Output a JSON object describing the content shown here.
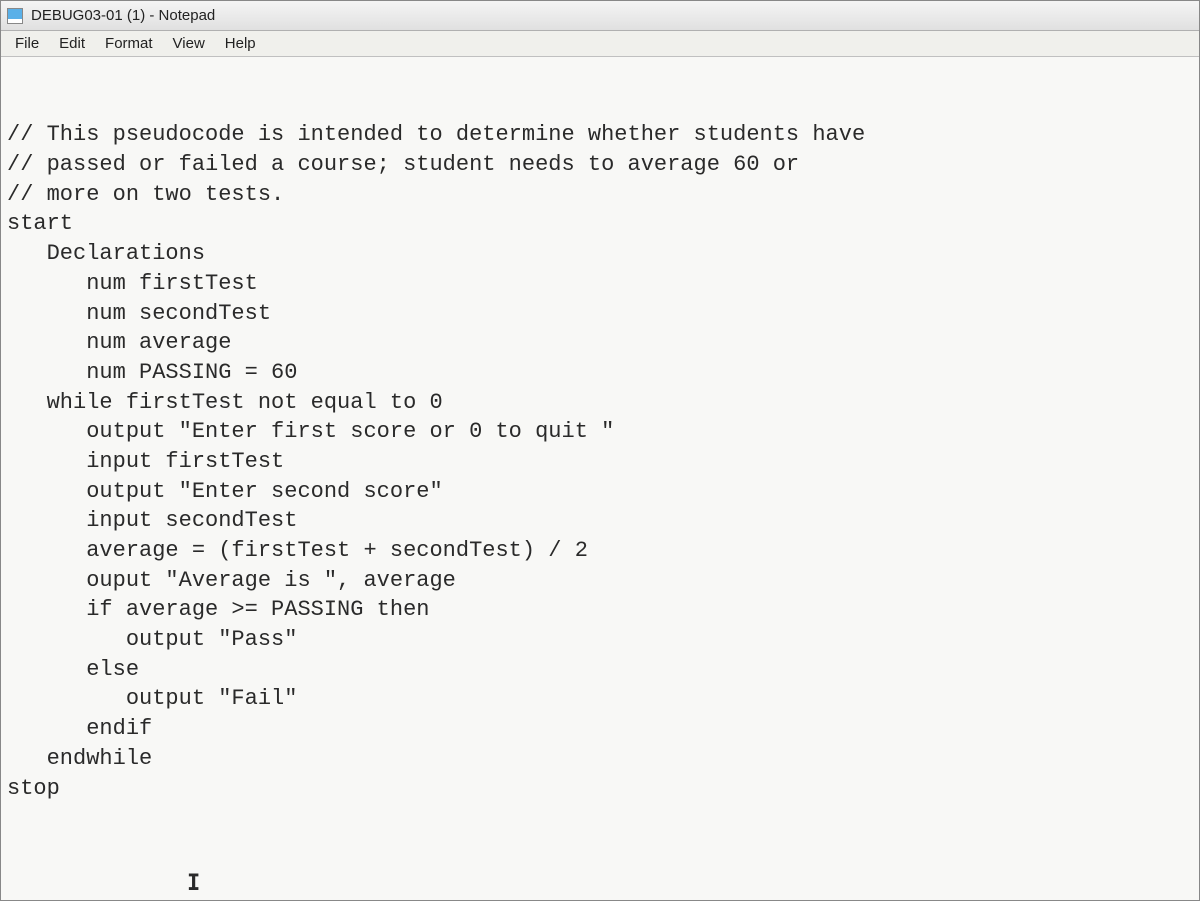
{
  "window": {
    "title": "DEBUG03-01 (1) - Notepad"
  },
  "menu": {
    "file": "File",
    "edit": "Edit",
    "format": "Format",
    "view": "View",
    "help": "Help"
  },
  "editor": {
    "lines": [
      "// This pseudocode is intended to determine whether students have",
      "// passed or failed a course; student needs to average 60 or",
      "// more on two tests.",
      "start",
      "   Declarations",
      "      num firstTest",
      "      num secondTest",
      "      num average",
      "      num PASSING = 60",
      "   while firstTest not equal to 0",
      "      output \"Enter first score or 0 to quit \"",
      "      input firstTest",
      "      output \"Enter second score\"",
      "      input secondTest",
      "      average = (firstTest + secondTest) / 2",
      "      ouput \"Average is \", average",
      "      if average >= PASSING then",
      "         output \"Pass\"",
      "      else",
      "         output \"Fail\"",
      "      endif",
      "   endwhile",
      "stop"
    ],
    "cursor_glyph": "I"
  }
}
